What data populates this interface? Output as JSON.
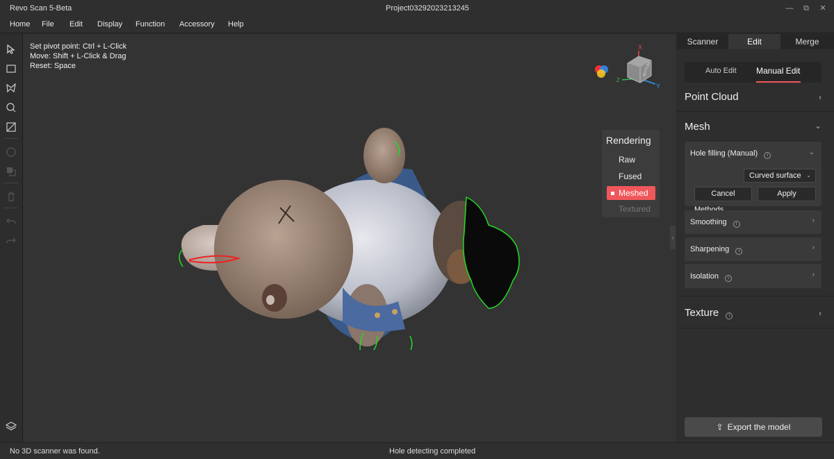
{
  "app": {
    "name": "Revo Scan 5-Beta",
    "project": "Project03292023213245"
  },
  "window_controls": {
    "minimize": "—",
    "restore": "⧉",
    "close": "✕"
  },
  "menu": [
    "Home",
    "File",
    "Edit",
    "Display",
    "Function",
    "Accessory",
    "Help"
  ],
  "toolbar_icons": [
    "select-arrow-icon",
    "rectangle-select-icon",
    "lasso-select-icon",
    "brush-select-icon",
    "invert-select-icon",
    "reset-icon",
    "copy-icon",
    "trash-icon",
    "undo-icon",
    "redo-icon",
    "layers-icon"
  ],
  "viewport": {
    "hints": [
      "Set pivot point:  Ctrl + L-Click",
      "Move:  Shift + L-Click & Drag",
      "Reset:  Space"
    ],
    "axes": {
      "x": "X",
      "y": "Y",
      "z": "Z",
      "cube_face": "BOTTOM"
    },
    "rendering": {
      "title": "Rendering",
      "options": [
        "Raw",
        "Fused",
        "Meshed",
        "Textured"
      ],
      "selected": "Meshed",
      "disabled": "Textured"
    },
    "accent": "#f0575a",
    "hole_outline_color": "#22dd22",
    "selection_color": "#ee2222"
  },
  "right_panel": {
    "tabs": [
      "Scanner",
      "Edit",
      "Merge"
    ],
    "active_tab": "Edit",
    "subtabs": [
      "Auto Edit",
      "Manual Edit"
    ],
    "active_subtab": "Manual Edit",
    "sections": {
      "point_cloud": "Point Cloud",
      "mesh": "Mesh",
      "texture": "Texture"
    },
    "hole_filling": {
      "title": "Hole filling (Manual)",
      "methods_label": "Methods",
      "method_value": "Curved surface",
      "cancel": "Cancel",
      "apply": "Apply"
    },
    "tools": [
      "Smoothing",
      "Sharpening",
      "Isolation"
    ],
    "export": "Export the model"
  },
  "status": {
    "left": "No 3D scanner was found.",
    "center": "Hole detecting completed"
  }
}
